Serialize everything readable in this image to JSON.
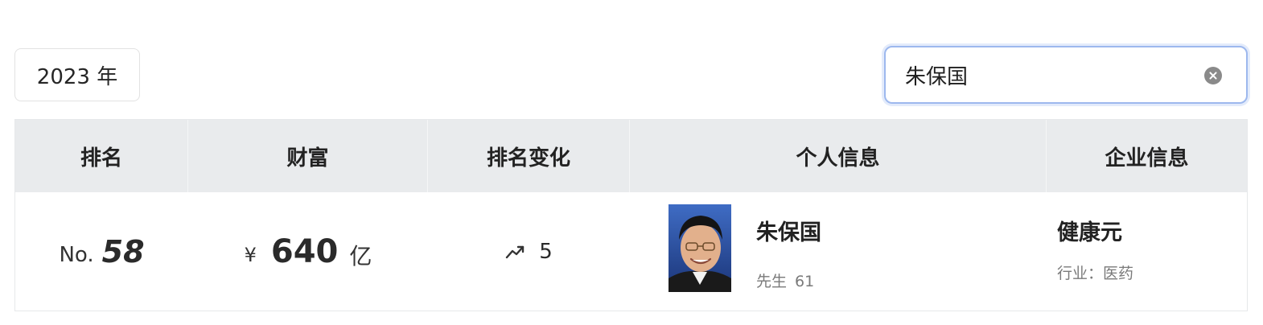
{
  "controls": {
    "year_select": "2023 年",
    "search_value": "朱保国"
  },
  "table": {
    "headers": {
      "rank": "排名",
      "wealth": "财富",
      "rank_change": "排名变化",
      "person": "个人信息",
      "company": "企业信息"
    },
    "rows": [
      {
        "rank_prefix": "No.",
        "rank": "58",
        "currency": "¥",
        "wealth": "640",
        "wealth_unit": "亿",
        "change_icon": "trend-up-icon",
        "change": "5",
        "name": "朱保国",
        "title": "先生",
        "age": "61",
        "company": "健康元",
        "industry": "行业：医药"
      }
    ]
  },
  "colors": {
    "header_bg": "#e9ebed",
    "search_focus_border": "#9db8ee"
  }
}
